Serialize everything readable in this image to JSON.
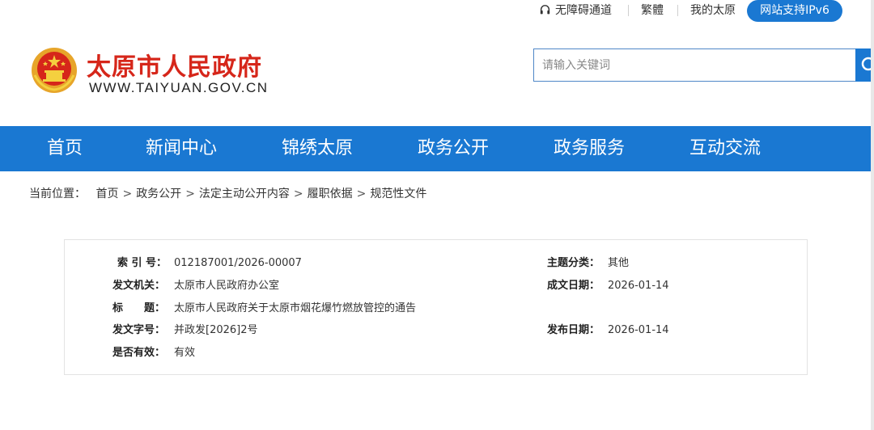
{
  "topbar": {
    "accessibility": "无障碍通道",
    "traditional": "繁體",
    "my_taiyuan": "我的太原",
    "ipv6": "网站支持IPv6"
  },
  "header": {
    "site_title": "太原市人民政府",
    "site_url": "WWW.TAIYUAN.GOV.CN",
    "search_placeholder": "请输入关键词"
  },
  "nav": {
    "items": [
      {
        "label": "首页"
      },
      {
        "label": "新闻中心"
      },
      {
        "label": "锦绣太原"
      },
      {
        "label": "政务公开"
      },
      {
        "label": "政务服务"
      },
      {
        "label": "互动交流"
      }
    ]
  },
  "breadcrumb": {
    "prefix": "当前位置：",
    "items": [
      "首页",
      "政务公开",
      "法定主动公开内容",
      "履职依据",
      "规范性文件"
    ],
    "separator": ">"
  },
  "info": {
    "index_label": "索 引 号：",
    "index_value": "012187001/2026-00007",
    "topic_label": "主题分类：",
    "topic_value": "其他",
    "issuer_label": "发文机关：",
    "issuer_value": "太原市人民政府办公室",
    "created_label": "成文日期：",
    "created_value": "2026-01-14",
    "title_label": "标　　题：",
    "title_value": "太原市人民政府关于太原市烟花爆竹燃放管控的通告",
    "doc_no_label": "发文字号：",
    "doc_no_value": "并政发[2026]2号",
    "published_label": "发布日期：",
    "published_value": "2026-01-14",
    "valid_label": "是否有效：",
    "valid_value": "有效"
  },
  "colors": {
    "brand_blue": "#1a78d2",
    "title_red": "#d6261a"
  }
}
